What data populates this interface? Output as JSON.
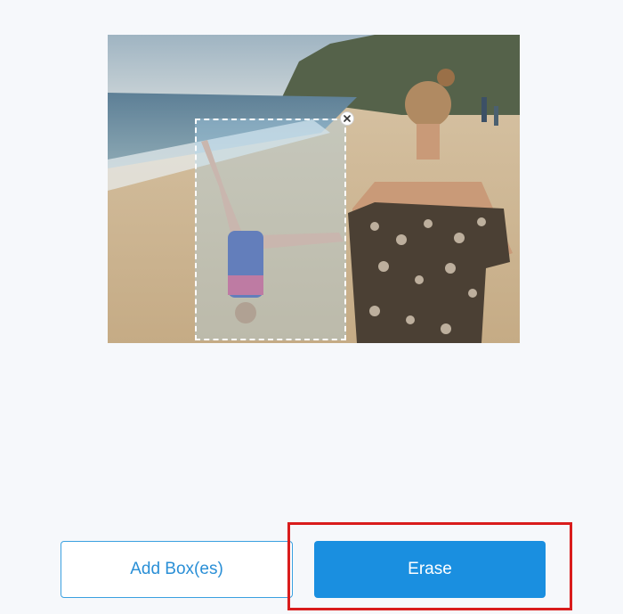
{
  "editor": {
    "photo_icon": "beach-photo",
    "selection_close_icon": "close-icon"
  },
  "actions": {
    "add_box_label": "Add Box(es)",
    "erase_label": "Erase"
  },
  "colors": {
    "background": "#f6f8fb",
    "accent": "#1a8fe0",
    "highlight": "#d91c1c"
  }
}
